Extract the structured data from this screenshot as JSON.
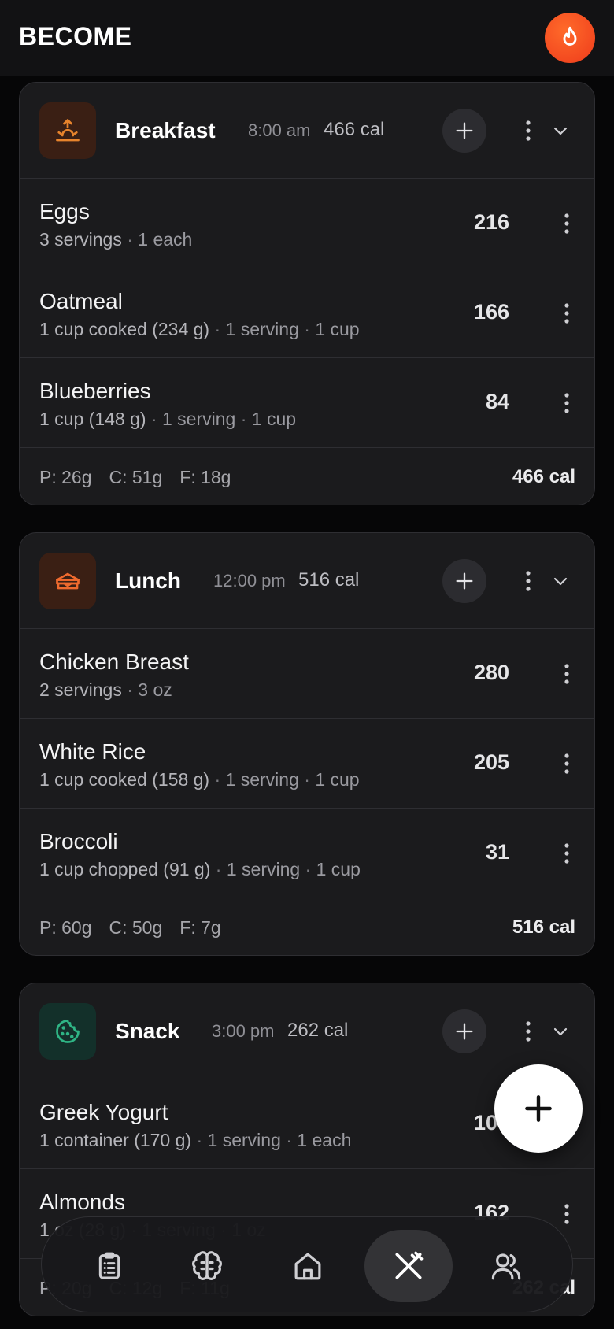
{
  "app": {
    "title": "BECOME"
  },
  "meals": [
    {
      "title": "Breakfast",
      "time": "8:00 am",
      "calories": "466 cal",
      "icon": "sunrise-icon",
      "icon_color": "#e8842c",
      "icon_bg": "#3a1f14",
      "items": [
        {
          "name": "Eggs",
          "desc_main": "3 servings",
          "desc_rest": [
            "1 each"
          ],
          "cal": "216"
        },
        {
          "name": "Oatmeal",
          "desc_main": "1 cup cooked (234 g)",
          "desc_rest": [
            "1 serving",
            "1 cup"
          ],
          "cal": "166"
        },
        {
          "name": "Blueberries",
          "desc_main": "1 cup (148 g)",
          "desc_rest": [
            "1 serving",
            "1 cup"
          ],
          "cal": "84"
        }
      ],
      "macros": {
        "p": "P: 26g",
        "c": "C: 51g",
        "f": "F: 18g"
      },
      "total": "466 cal"
    },
    {
      "title": "Lunch",
      "time": "12:00 pm",
      "calories": "516 cal",
      "icon": "sandwich-icon",
      "icon_color": "#ef6a2e",
      "icon_bg": "#3a1f14",
      "items": [
        {
          "name": "Chicken Breast",
          "desc_main": "2 servings",
          "desc_rest": [
            "3 oz"
          ],
          "cal": "280"
        },
        {
          "name": "White Rice",
          "desc_main": "1 cup cooked (158 g)",
          "desc_rest": [
            "1 serving",
            "1 cup"
          ],
          "cal": "205"
        },
        {
          "name": "Broccoli",
          "desc_main": "1 cup chopped (91 g)",
          "desc_rest": [
            "1 serving",
            "1 cup"
          ],
          "cal": "31"
        }
      ],
      "macros": {
        "p": "P: 60g",
        "c": "C: 50g",
        "f": "F: 7g"
      },
      "total": "516 cal"
    },
    {
      "title": "Snack",
      "time": "3:00 pm",
      "calories": "262 cal",
      "icon": "cookie-icon",
      "icon_color": "#2fb585",
      "icon_bg": "#13302a",
      "items": [
        {
          "name": "Greek Yogurt",
          "desc_main": "1 container (170 g)",
          "desc_rest": [
            "1 serving",
            "1 each"
          ],
          "cal": "100"
        },
        {
          "name": "Almonds",
          "desc_main": "1 oz (28 g)",
          "desc_rest": [
            "1 serving",
            "1 oz"
          ],
          "cal": "162"
        }
      ],
      "macros": {
        "p": "P: 20g",
        "c": "C: 12g",
        "f": "F: 11g"
      },
      "total": "262 cal"
    }
  ],
  "nav": {
    "items": [
      {
        "name": "clipboard-icon",
        "active": false
      },
      {
        "name": "brain-icon",
        "active": false
      },
      {
        "name": "home-icon",
        "active": false
      },
      {
        "name": "utensils-icon",
        "active": true
      },
      {
        "name": "users-icon",
        "active": false
      }
    ]
  },
  "colors": {
    "accent": "#ee3b1b",
    "card_bg": "#1b1b1d",
    "page_bg": "#060607"
  }
}
